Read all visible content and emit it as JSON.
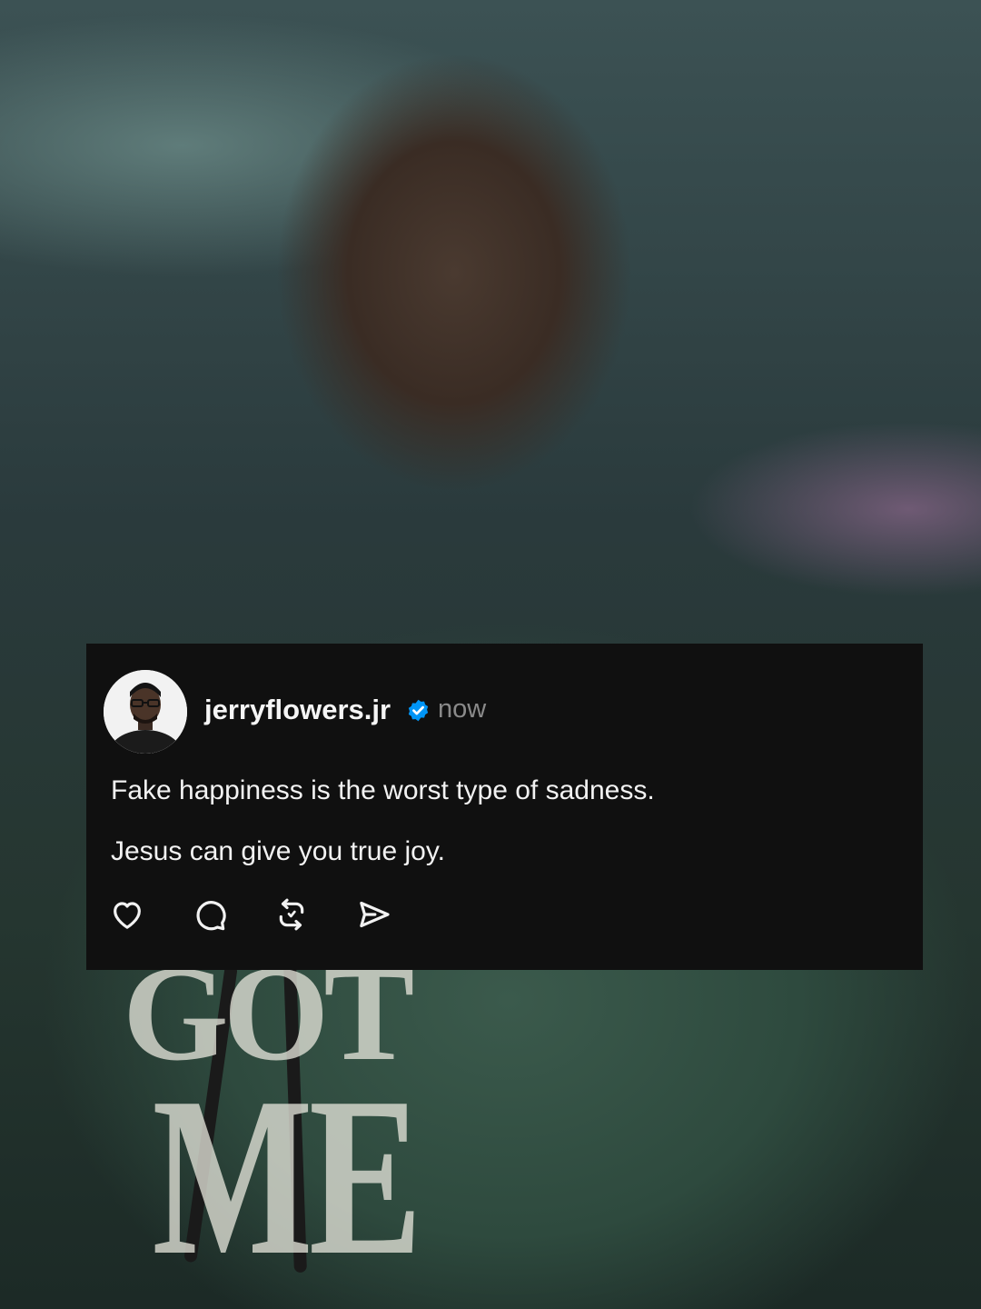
{
  "post": {
    "username": "jerryflowers.jr",
    "verified": true,
    "timestamp": "now",
    "lines": [
      "Fake happiness is the worst type of sadness.",
      "Jesus can give you true joy."
    ]
  },
  "actions": [
    {
      "icon": "heart-icon"
    },
    {
      "icon": "comment-icon"
    },
    {
      "icon": "repost-icon"
    },
    {
      "icon": "share-icon"
    }
  ],
  "background": {
    "hoodie_text": [
      "GOT",
      "ME"
    ]
  },
  "colors": {
    "card_bg": "#101010",
    "text_primary": "#f5f5f5",
    "text_secondary": "#8a8a8a",
    "verified_badge": "#0095f6"
  }
}
